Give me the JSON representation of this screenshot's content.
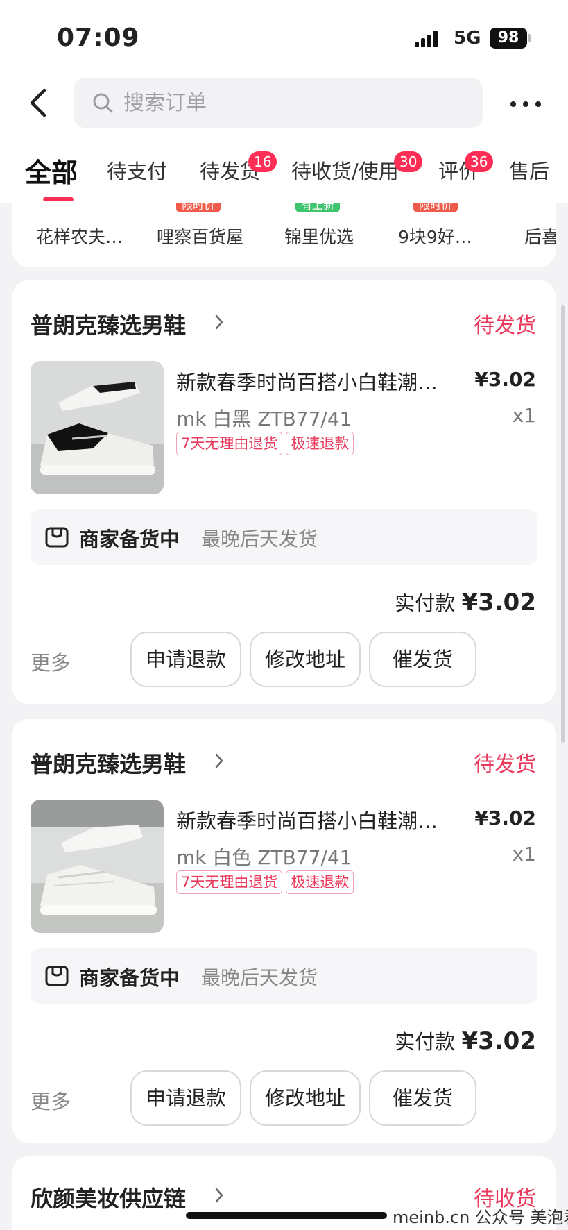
{
  "status_bar": {
    "time": "07:09",
    "network": "5G",
    "battery": "98"
  },
  "search": {
    "placeholder": "搜索订单"
  },
  "tabs": [
    {
      "label": "全部"
    },
    {
      "label": "待支付"
    },
    {
      "label": "待发货",
      "badge": "16"
    },
    {
      "label": "待收货/使用",
      "badge": "30"
    },
    {
      "label": "评价",
      "badge": "36"
    },
    {
      "label": "售后"
    }
  ],
  "shops": [
    {
      "name": "花样农夫…"
    },
    {
      "name": "哩察百货屋",
      "tag": "限时价"
    },
    {
      "name": "锦里优选",
      "tag": "有上新"
    },
    {
      "name": "9块9好…",
      "tag": "限时价"
    },
    {
      "name": "后喜"
    }
  ],
  "orders": [
    {
      "store": "普朗克臻选男鞋",
      "status": "待发货",
      "title": "新款春季时尚百搭小白鞋潮…",
      "price": "¥3.02",
      "spec": "mk 白黑 ZTB77/41",
      "qty": "x1",
      "tags": [
        "7天无理由退货",
        "极速退款"
      ],
      "ship_state": "商家备货中",
      "ship_time": "最晚后天发货",
      "paid_label": "实付款",
      "paid_amount": "¥3.02",
      "more": "更多",
      "buttons": [
        "申请退款",
        "修改地址",
        "催发货"
      ]
    },
    {
      "store": "普朗克臻选男鞋",
      "status": "待发货",
      "title": "新款春季时尚百搭小白鞋潮…",
      "price": "¥3.02",
      "spec": "mk 白色 ZTB77/41",
      "qty": "x1",
      "tags": [
        "7天无理由退货",
        "极速退款"
      ],
      "ship_state": "商家备货中",
      "ship_time": "最晚后天发货",
      "paid_label": "实付款",
      "paid_amount": "¥3.02",
      "more": "更多",
      "buttons": [
        "申请退款",
        "修改地址",
        "催发货"
      ]
    },
    {
      "store": "欣颜美妆供应链",
      "status": "待收货"
    }
  ],
  "watermark": "meinb.cn 公众号 美泡君",
  "colors": {
    "accent": "#ff2e55",
    "status_text": "#e83a5c",
    "tag_green": "#3ec46d"
  }
}
